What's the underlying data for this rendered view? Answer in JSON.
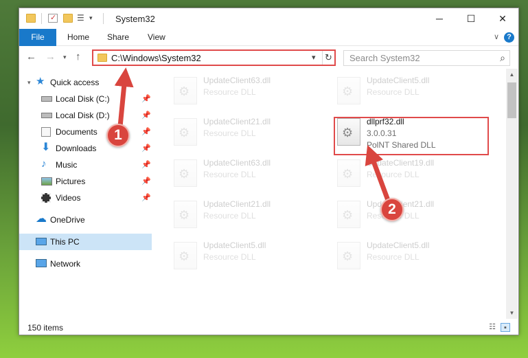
{
  "window": {
    "title": "System32",
    "controls": {
      "minimize": "─",
      "maximize": "☐",
      "close": "✕"
    }
  },
  "ribbon": {
    "tabs": [
      "File",
      "Home",
      "Share",
      "View"
    ],
    "help": "?"
  },
  "nav": {
    "address_path": "C:\\Windows\\System32",
    "search_placeholder": "Search System32"
  },
  "sidebar": {
    "quick_access": {
      "label": "Quick access",
      "items": [
        {
          "label": "Local Disk (C:)",
          "icon": "drive-icon",
          "pinned": true
        },
        {
          "label": "Local Disk (D:)",
          "icon": "drive-icon",
          "pinned": true
        },
        {
          "label": "Documents",
          "icon": "documents-icon",
          "pinned": true
        },
        {
          "label": "Downloads",
          "icon": "download-arrow-icon",
          "pinned": true
        },
        {
          "label": "Music",
          "icon": "music-note-icon",
          "pinned": true
        },
        {
          "label": "Pictures",
          "icon": "pictures-icon",
          "pinned": true
        },
        {
          "label": "Videos",
          "icon": "film-icon",
          "pinned": true
        }
      ]
    },
    "onedrive": "OneDrive",
    "this_pc": "This PC",
    "network": "Network"
  },
  "files": [
    {
      "name": "UpdateClient63.dll",
      "desc": "Resource DLL"
    },
    {
      "name": "UpdateClient5.dll",
      "desc": "Resource DLL"
    },
    {
      "name": "UpdateClient21.dll",
      "desc": "Resource DLL"
    },
    {
      "name": "dllprf32.dll",
      "version": "3.0.0.31",
      "desc": "PolNT Shared DLL"
    },
    {
      "name": "UpdateClient63.dll",
      "desc": "Resource DLL"
    },
    {
      "name": "UpdateClient19.dll",
      "desc": "Resource DLL"
    },
    {
      "name": "UpdateClient21.dll",
      "desc": "Resource DLL"
    },
    {
      "name": "UpdateClient21.dll",
      "desc": "Resource DLL"
    },
    {
      "name": "UpdateClient5.dll",
      "desc": "Resource DLL"
    },
    {
      "name": "UpdateClient5.dll",
      "desc": "Resource DLL"
    }
  ],
  "status": {
    "item_count": "150 items"
  },
  "callouts": {
    "one": "1",
    "two": "2"
  },
  "colors": {
    "accent": "#1979ca",
    "highlight": "#e04a4a",
    "selected": "#cce4f7"
  }
}
